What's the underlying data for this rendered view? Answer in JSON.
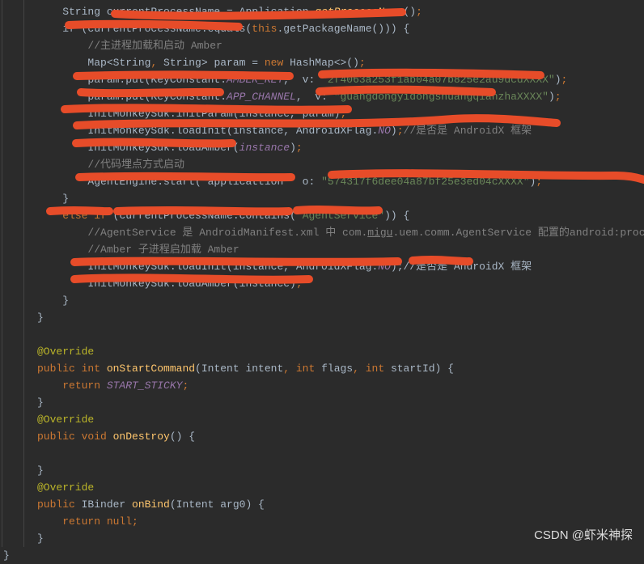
{
  "watermark": "CSDN @虾米神探",
  "code": {
    "l1_a": "    String currentProcessName = Application.",
    "l1_b": "getProcessName",
    "l1_c": "()",
    "l1_d": ";",
    "l2_a": "    i",
    "l2_b": "f (currentProcessName.equals(",
    "l2_c": "this",
    "l2_d": ".getPackageName())) {",
    "l3": "        //主进程加载和启动 Amber",
    "l4_a": "        Map<String",
    "l4_b": ", ",
    "l4_c": "String> param = ",
    "l4_d": "new ",
    "l4_e": "HashMap<>()",
    "l4_f": ";",
    "l5_a": "        param.put(KeyConstant.",
    "l5_b": "AMBER_KEY",
    "l5_c": ",  v: ",
    "l5_d": "\"2f4063a253f1ab04a07b825e2au9dcdXXXX\"",
    "l5_e": ")",
    "l5_f": ";",
    "l6_a": "        param.put(KeyConstant.",
    "l6_b": "APP_CHANNEL",
    "l6_c": ",  v: ",
    "l6_d": "\"guangdongyidongshuangqianzhaXXXX\"",
    "l6_e": ")",
    "l6_f": ";",
    "l7_a": "        InitMonkeySdk.initParam(instance, param)",
    "l7_b": ";",
    "l8_a": "        InitMonkeySdk.loadInit(instance, AndroidXFlag.",
    "l8_b": "NO",
    "l8_c": ")",
    "l8_d": ";",
    "l8_e": "//是否是 AndroidX 框架",
    "l9_a": "        InitMonkeySdk.loadAmber(",
    "l9_b": "instance",
    "l9_c": ")",
    "l9_d": ";",
    "l10": "        //代码埋点方式启动",
    "l11_a": "        AgentEngine.start( applicattion   o: ",
    "l11_b": "\"574317f6dee04a87bf25e3ed04cXXXX\"",
    "l11_c": ")",
    "l11_d": ";",
    "l12": "    }",
    "l13_a": "    ",
    "l13_b": "else if ",
    "l13_c": "(currentProcessName.contains(",
    "l13_d": "\"AgentService\"",
    "l13_e": ")) {",
    "l14": "        //AgentService 是 AndroidManifest.xml 中 com.",
    "l14b": "migu",
    "l14c": ".uem.comm.AgentService 配置的android:proc",
    "l15": "        //Amber 子进程启加载 Amber",
    "l16_a": "        InitMonkeySdk.loadInit(instance, AndroidXFlag.",
    "l16_b": "NO",
    "l16_c": ");//是否是 AndroidX 框架",
    "l17_a": "        InitMonkeySdk.loadAmber(instance)",
    "l17_b": ";",
    "l18": "    }",
    "l19": "}",
    "l21": "@Override",
    "l22_a": "public ",
    "l22_b": "int ",
    "l22_c": "onStartCommand",
    "l22_d": "(Intent intent",
    "l22_e": ", ",
    "l22_f": "int ",
    "l22_g": "flags",
    "l22_h": ", ",
    "l22_i": "int ",
    "l22_j": "startId) {",
    "l23_a": "    ",
    "l23_b": "return ",
    "l23_c": "START_STICKY",
    "l23_d": ";",
    "l24": "}",
    "l25": "@Override",
    "l26_a": "public ",
    "l26_b": "void ",
    "l26_c": "onDestroy",
    "l26_d": "() {",
    "l28": "}",
    "l29": "@Override",
    "l30_a": "public ",
    "l30_b": "IBinder ",
    "l30_c": "onBind",
    "l30_d": "(Intent arg0) {",
    "l31_a": "    ",
    "l31_b": "return null",
    "l31_c": ";",
    "l32": "}",
    "l33": "}"
  }
}
